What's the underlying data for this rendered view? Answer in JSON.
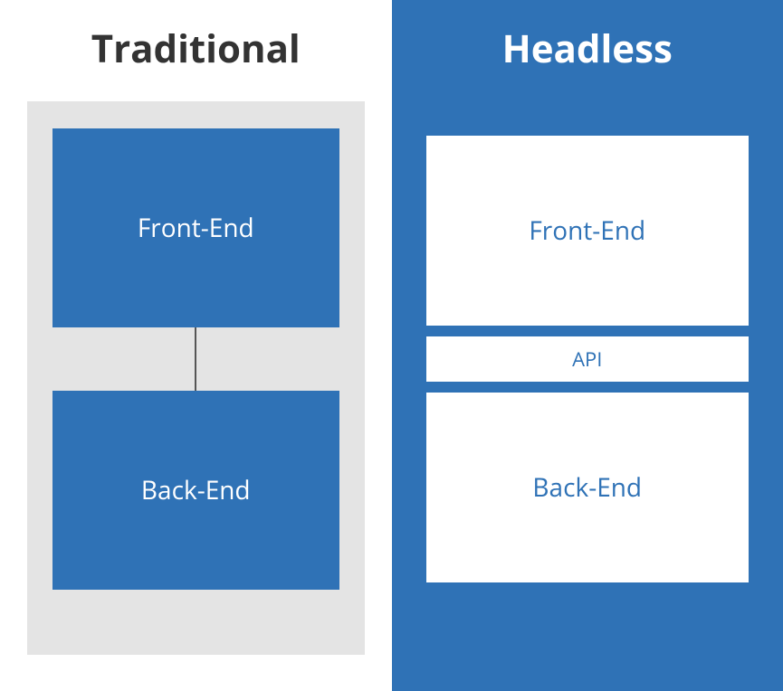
{
  "diagram": {
    "left": {
      "title": "Traditional",
      "boxes": {
        "frontend": "Front-End",
        "backend": "Back-End"
      }
    },
    "right": {
      "title": "Headless",
      "boxes": {
        "frontend": "Front-End",
        "api": "API",
        "backend": "Back-End"
      }
    }
  }
}
